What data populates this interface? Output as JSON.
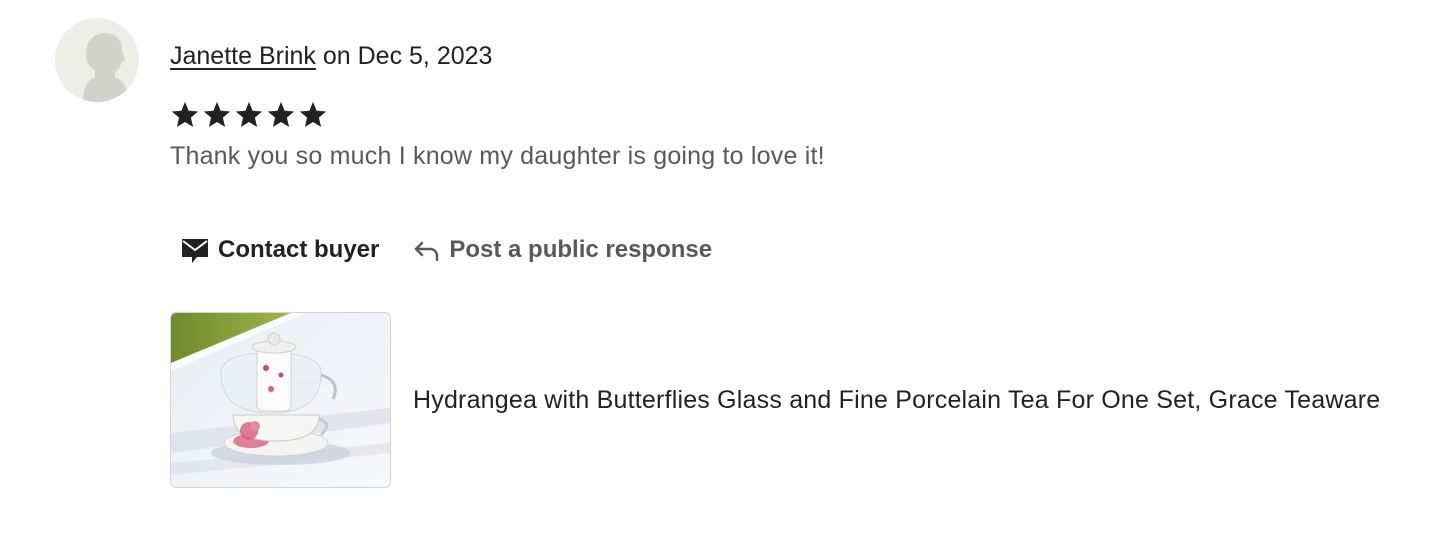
{
  "review": {
    "reviewer_name": "Janette Brink",
    "date_text": "on Dec 5, 2023",
    "rating": 5,
    "rating_max": 5,
    "text": "Thank you so much I know my daughter is going to love it!",
    "actions": {
      "contact_label": "Contact buyer",
      "contact_icon": "envelope-icon",
      "respond_label": "Post a public response",
      "respond_icon": "reply-arrow-icon"
    },
    "listing": {
      "title": "Hydrangea with Butterflies Glass and Fine Porcelain Tea For One Set, Grace Teaware",
      "thumbnail_icon": "teapot-photo"
    },
    "avatar_icon": "default-user-silhouette",
    "colors": {
      "star": "#222222",
      "text_primary": "#222222",
      "text_secondary": "#595959"
    }
  }
}
